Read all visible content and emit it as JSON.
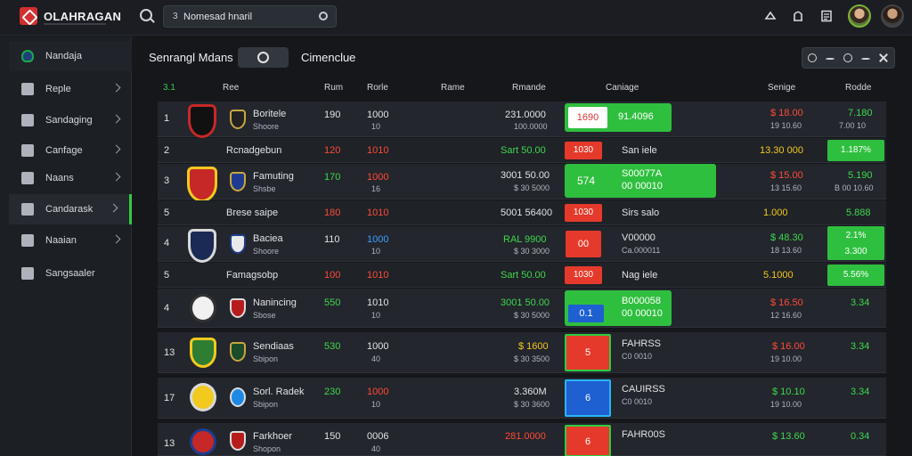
{
  "app": {
    "brand": "OLAHRAGAN"
  },
  "topbar": {
    "search_prefix": "3",
    "search_value": "Nomesad hnaril"
  },
  "sidebar": {
    "items": [
      {
        "label": "Nandaja"
      },
      {
        "label": "Reple"
      },
      {
        "label": "Sandaging"
      },
      {
        "label": "Canfage"
      },
      {
        "label": "Naans"
      },
      {
        "label": "Candarask"
      },
      {
        "label": "Naaian"
      },
      {
        "label": "Sangsaaler"
      }
    ]
  },
  "main": {
    "title": "Senrangl Mdans",
    "subtitle": "Cimenclue"
  },
  "table": {
    "headers": {
      "rank": "3.1",
      "team": "Ree",
      "col_a": "Rum",
      "col_b": "Rorle",
      "col_c": "Rame",
      "col_d": "Rmande",
      "col_e": "Caniage",
      "col_f": "Senige",
      "col_g": "Rodde"
    },
    "rows": [
      {
        "rank": "1",
        "name": "Boritele",
        "sub": "Shoore",
        "a": "190",
        "b": "1000",
        "b_sub": "10",
        "c": "231.0000",
        "c_sub": "100.0000",
        "pill": "1690",
        "pill_text": "91.4096",
        "f": "$ 18.00",
        "f_sub": "19 10.60",
        "g": "7.180",
        "g_sub": "7.00 10"
      },
      {
        "rank": "2",
        "name": "Rcnadgebun",
        "a": "120",
        "b": "1010",
        "c": "Sart 50.00",
        "mini": "1030",
        "mini_text": "San iele",
        "f": "13.30 000",
        "g": "1.187%"
      },
      {
        "rank": "3",
        "name": "Famuting",
        "sub": "Shsbe",
        "a": "170",
        "b": "1000",
        "b_sub": "16",
        "c": "3001 50.00",
        "c_sub": "$ 30 5000",
        "pill": "574",
        "pill_text": "S00077A",
        "pill_text2": "00 00010",
        "f": "$ 15.00",
        "f_sub": "13 15.60",
        "g": "5.190",
        "g_sub": "B 00 10.60"
      },
      {
        "rank": "5",
        "name": "Brese saipe",
        "a": "180",
        "b": "1010",
        "c": "5001 56400",
        "mini": "1030",
        "mini_text": "Sirs salo",
        "f": "1.000",
        "g": "5.888"
      },
      {
        "rank": "4",
        "name": "Baciea",
        "sub": "Shoore",
        "a": "110",
        "b": "1000",
        "b_sub": "10",
        "c": "RAL 9900",
        "c_sub": "$ 30 3000",
        "pill": "00",
        "pill_text": "V00000",
        "pill_text2": "Ca.000011",
        "f": "$ 48.30",
        "f_sub": "18 13.60",
        "g": "2.1%",
        "g_sub": "3.300"
      },
      {
        "rank": "5",
        "name": "Famagsobp",
        "a": "100",
        "b": "1010",
        "c": "Sart 50.00",
        "mini": "1030",
        "mini_text": "Nag iele",
        "f": "5.1000",
        "g": "5.56%"
      },
      {
        "rank": "4",
        "name": "Nanincing",
        "sub": "Sbose",
        "a": "550",
        "b": "1010",
        "b_sub": "10",
        "c": "3001 50.00",
        "c_sub": "$ 30 5000",
        "pill": "0.1",
        "pill_text": "B000058",
        "pill_text2": "00 00010",
        "f": "$ 16.50",
        "f_sub": "12 16.60",
        "g": "3.34",
        "g_sub": ""
      },
      {
        "rank": "13",
        "name": "Sendiaas",
        "sub": "Sbipon",
        "a": "530",
        "b": "1000",
        "b_sub": "40",
        "c": "$ 1600",
        "c_sub": "$ 30 3500",
        "pill": "5",
        "pill_text": "FAHRSS",
        "pill_text2": "C0 0010",
        "f": "$ 16.00",
        "f_sub": "19 10.00",
        "g": "3.34",
        "g_sub": ""
      },
      {
        "rank": "17",
        "name": "Sorl. Radek",
        "sub": "Sbipon",
        "a": "230",
        "b": "1000",
        "b_sub": "10",
        "c": "3.360M",
        "c_sub": "$ 30 3600",
        "pill": "6",
        "pill_text": "CAUIRSS",
        "pill_text2": "C0 0010",
        "f": "$ 10.10",
        "f_sub": "19 10.00",
        "g": "3.34",
        "g_sub": ""
      },
      {
        "rank": "13",
        "name": "Farkhoer",
        "sub": "Shopon",
        "a": "150",
        "b": "0006",
        "b_sub": "40",
        "c": "281.0000",
        "c_sub": "",
        "pill": "6",
        "pill_text": "FAHR00S",
        "pill_text2": "",
        "f": "$ 13.60",
        "f_sub": "",
        "g": "0.34",
        "g_sub": ""
      }
    ]
  },
  "colors": {
    "accent_green": "#2ecc40",
    "alert_red": "#e53a2b",
    "blue": "#1e88e5",
    "panel": "#23262c"
  }
}
